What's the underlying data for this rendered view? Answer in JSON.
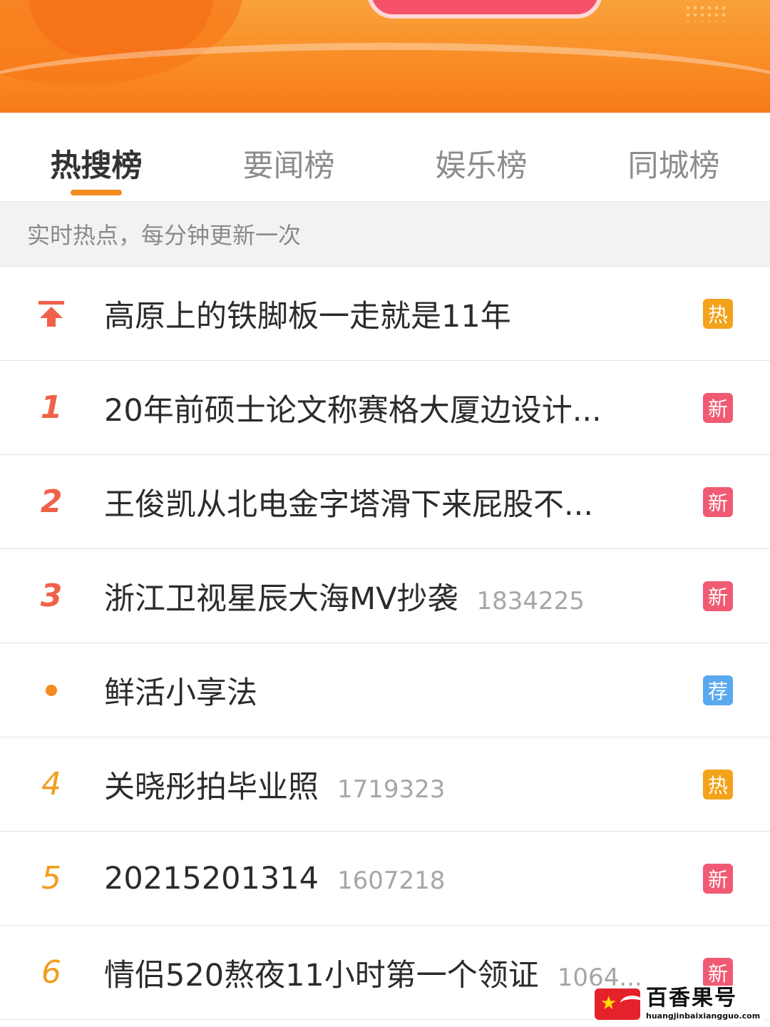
{
  "colors": {
    "accent": "#f28a1f",
    "badge_hot": "#f3a31b",
    "badge_new": "#f05a73",
    "badge_recommend": "#5aa9ef",
    "rank_top": "#f0614a",
    "rank_mid": "#f29d1c"
  },
  "tabs": [
    {
      "label": "热搜榜",
      "active": true
    },
    {
      "label": "要闻榜",
      "active": false
    },
    {
      "label": "娱乐榜",
      "active": false
    },
    {
      "label": "同城榜",
      "active": false
    }
  ],
  "subheader": "实时热点，每分钟更新一次",
  "items": [
    {
      "rank": "",
      "marker": "pinned-top-icon",
      "title": "高原上的铁脚板一走就是11年",
      "count": "",
      "badge": "热",
      "badge_type": "hot"
    },
    {
      "rank": "1",
      "marker": "",
      "title": "20年前硕士论文称赛格大厦边设计...",
      "count": "",
      "badge": "新",
      "badge_type": "new"
    },
    {
      "rank": "2",
      "marker": "",
      "title": "王俊凯从北电金字塔滑下来屁股不...",
      "count": "",
      "badge": "新",
      "badge_type": "new"
    },
    {
      "rank": "3",
      "marker": "",
      "title": "浙江卫视星辰大海MV抄袭",
      "count": "1834225",
      "badge": "新",
      "badge_type": "new"
    },
    {
      "rank": "",
      "marker": "promoted-dot-icon",
      "title": "鲜活小享法",
      "count": "",
      "badge": "荐",
      "badge_type": "recommend"
    },
    {
      "rank": "4",
      "marker": "",
      "title": "关晓彤拍毕业照",
      "count": "1719323",
      "badge": "热",
      "badge_type": "hot"
    },
    {
      "rank": "5",
      "marker": "",
      "title": "20215201314",
      "count": "1607218",
      "badge": "新",
      "badge_type": "new"
    },
    {
      "rank": "6",
      "marker": "",
      "title": "情侣520熬夜11小时第一个领证",
      "count": "1064...",
      "badge": "新",
      "badge_type": "new"
    }
  ],
  "watermark": {
    "name": "百香果号",
    "url": "huangjinbaixiangguo.com"
  }
}
